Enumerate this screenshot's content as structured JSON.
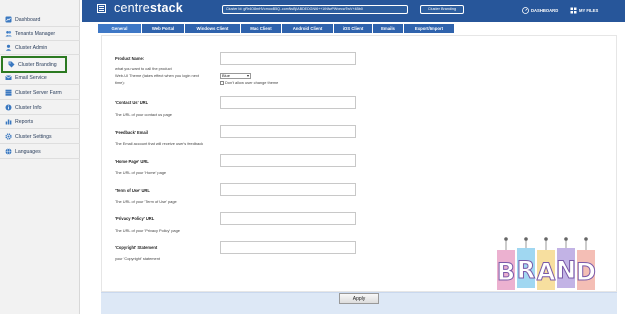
{
  "sidebar": {
    "items": [
      {
        "label": "Dashboard",
        "icon": "dashboard-icon"
      },
      {
        "label": "Tenants Manager",
        "icon": "tenants-icon"
      },
      {
        "label": "Cluster Admin",
        "icon": "admin-icon"
      },
      {
        "label": "Cluster Branding",
        "icon": "branding-tag-icon",
        "active": true
      },
      {
        "label": "Email Service",
        "icon": "email-icon"
      },
      {
        "label": "Cluster Server Farm",
        "icon": "server-farm-icon"
      },
      {
        "label": "Cluster Info",
        "icon": "info-icon"
      },
      {
        "label": "Reports",
        "icon": "reports-icon"
      },
      {
        "label": "Cluster Settings",
        "icon": "settings-icon"
      },
      {
        "label": "Languages",
        "icon": "globe-icon"
      }
    ]
  },
  "header": {
    "brand_light": "centre",
    "brand_bold": "stack",
    "cluster_id": "Cluster Id: gRr4O8mHVcmooB5Q..comNsBj\\ABDEDGNI6++1tNfwPWvecwTwV+4Bb0",
    "cluster_branding_label": "Cluster Branding",
    "dashboard_label": "DASHBOARD",
    "my_files_label": "MY FILES",
    "accent_color": "#27569a"
  },
  "tabs": [
    {
      "label": "General",
      "active": true
    },
    {
      "label": "Web Portal"
    },
    {
      "label": "Windows Client"
    },
    {
      "label": "Mac Client"
    },
    {
      "label": "Android Client"
    },
    {
      "label": "iOS Client"
    },
    {
      "label": "Emails"
    },
    {
      "label": "Export/Import"
    }
  ],
  "form": {
    "product_name": {
      "label": "Product Name:",
      "desc1": "what you want to call the product",
      "desc2": "Web-UI Theme (takes effect when you login next",
      "desc3": "time):",
      "theme_value": "Blue",
      "allow_change_label": "Don't allow user change theme",
      "value": ""
    },
    "contact_us": {
      "label": "'Contact Us' URL",
      "desc": "The URL of your contact us page",
      "value": ""
    },
    "feedback": {
      "label": "'Feedback' Email",
      "desc": "The Email account that will receive user's feedback",
      "value": ""
    },
    "home_page": {
      "label": "'Home Page' URL",
      "desc": "The URL of your 'Home' page",
      "value": ""
    },
    "terms": {
      "label": "'Term of Use' URL",
      "desc": "The URL of your 'Term of Use' page",
      "value": ""
    },
    "privacy": {
      "label": "'Privacy Policy' URL",
      "desc": "The URL of your 'Privacy Policy' page",
      "value": ""
    },
    "copyright": {
      "label": "'Copyright' Statement",
      "desc": "your 'Copyright' statement",
      "value": ""
    }
  },
  "footer": {
    "apply_label": "Apply"
  },
  "brand_art": {
    "letters": [
      "B",
      "R",
      "A",
      "N",
      "D"
    ],
    "colors": [
      "#e9a3c8",
      "#8fd0ee",
      "#f6d98e",
      "#b7a6e0",
      "#f2b3a8"
    ]
  }
}
